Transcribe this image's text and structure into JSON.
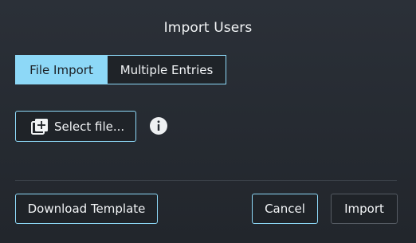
{
  "dialog": {
    "title": "Import Users"
  },
  "tabs": [
    {
      "label": "File Import",
      "active": true
    },
    {
      "label": "Multiple Entries",
      "active": false
    }
  ],
  "file_import": {
    "select_label": "Select file...",
    "select_icon": "add-file-icon",
    "info_icon": "info-icon"
  },
  "footer": {
    "download_label": "Download Template",
    "cancel_label": "Cancel",
    "import_label": "Import"
  },
  "colors": {
    "accent": "#8dd8f7",
    "background": "#262b32",
    "button_bg": "#1f2328",
    "disabled_border": "#555b63",
    "text": "#f2f4f6"
  }
}
